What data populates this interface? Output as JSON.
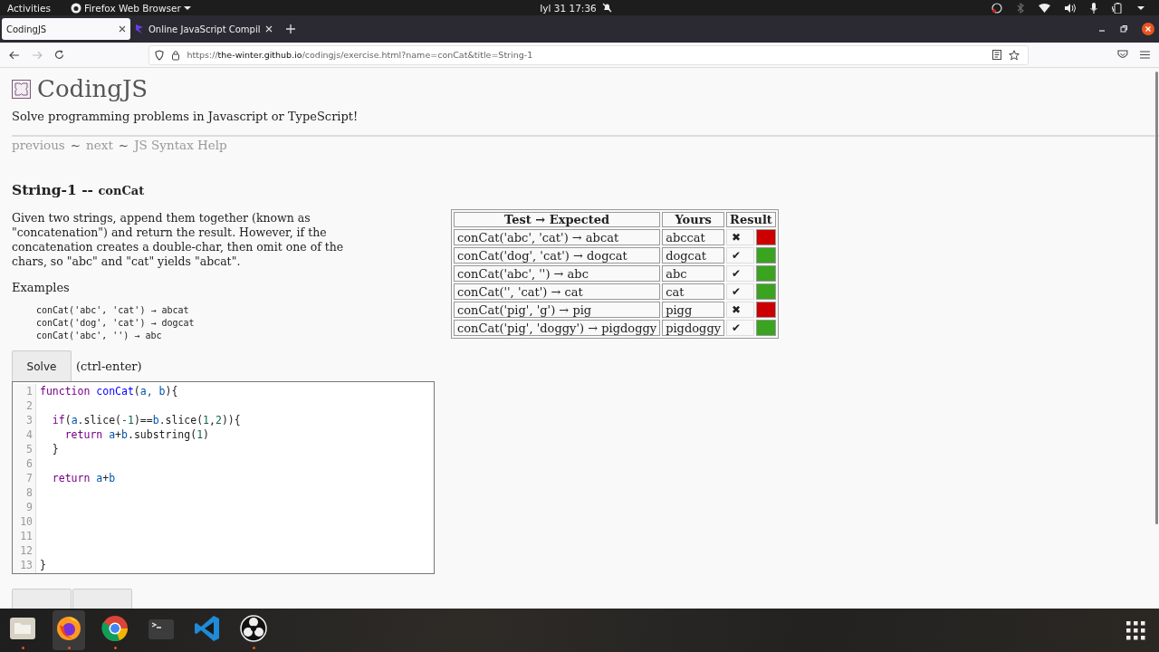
{
  "top_bar": {
    "activities": "Activities",
    "app_menu": "Firefox Web Browser",
    "clock": "Iyl 31  17:36"
  },
  "tabs": [
    {
      "title": "CodingJS",
      "selected": true
    },
    {
      "title": "Online JavaScript Compil",
      "selected": false
    }
  ],
  "address_bar": {
    "url_prefix": "https://",
    "url_host": "the-winter.github.io",
    "url_path": "/codingjs/exercise.html?name=conCat&title=String-1"
  },
  "page": {
    "logo_text": "CodingJS",
    "tagline": "Solve programming problems in Javascript or TypeScript!",
    "nav_links": [
      {
        "label": "previous"
      },
      {
        "label": "next"
      },
      {
        "label": "JS Syntax Help"
      }
    ],
    "nav_separator": "~",
    "title": "String-1 --",
    "title_name": "conCat",
    "description": "Given two strings, append them together (known as \"concatenation\") and return the result. However, if the concatenation creates a double-char, then omit one of the chars, so \"abc\" and \"cat\" yields \"abcat\".",
    "examples_label": "Examples",
    "examples": [
      "conCat('abc', 'cat') → abcat",
      "conCat('dog', 'cat') → dogcat",
      "conCat('abc', '') → abc"
    ],
    "solve_button": "Solve",
    "solve_hint": "(ctrl-enter)",
    "code_lines": [
      {
        "number": "1",
        "tokens": [
          {
            "text": "function",
            "kind": "keyword"
          },
          {
            "text": " conCat",
            "kind": "def"
          },
          {
            "text": "(",
            "kind": "plain"
          },
          {
            "text": "a",
            "kind": "var"
          },
          {
            "text": ", b",
            "kind": "var"
          },
          {
            "text": "){",
            "kind": "plain"
          }
        ]
      },
      {
        "number": "2"
      },
      {
        "number": "3",
        "tokens": [
          {
            "text": "  if",
            "kind": "keyword"
          },
          {
            "text": "(",
            "kind": "plain"
          },
          {
            "text": "a",
            "kind": "var"
          },
          {
            "text": ".slice(",
            "kind": "plain"
          },
          {
            "text": "-1",
            "kind": "number"
          },
          {
            "text": ")==",
            "kind": "plain"
          },
          {
            "text": "b",
            "kind": "var"
          },
          {
            "text": ".slice(",
            "kind": "plain"
          },
          {
            "text": "1",
            "kind": "number"
          },
          {
            "text": ",",
            "kind": "plain"
          },
          {
            "text": "2",
            "kind": "number"
          },
          {
            "text": ")){",
            "kind": "plain"
          }
        ]
      },
      {
        "number": "4",
        "tokens": [
          {
            "text": "    return",
            "kind": "keyword"
          },
          {
            "text": " a",
            "kind": "var"
          },
          {
            "text": "+",
            "kind": "plain"
          },
          {
            "text": "b",
            "kind": "var"
          },
          {
            "text": ".substring(",
            "kind": "plain"
          },
          {
            "text": "1",
            "kind": "number"
          },
          {
            "text": ")",
            "kind": "plain"
          }
        ]
      },
      {
        "number": "5",
        "tokens": [
          {
            "text": "  }",
            "kind": "plain"
          }
        ]
      },
      {
        "number": "6"
      },
      {
        "number": "7",
        "tokens": [
          {
            "text": "  return",
            "kind": "keyword"
          },
          {
            "text": " a",
            "kind": "var"
          },
          {
            "text": "+",
            "kind": "plain"
          },
          {
            "text": "b",
            "kind": "var"
          }
        ]
      },
      {
        "number": "8"
      },
      {
        "number": "9"
      },
      {
        "number": "10"
      },
      {
        "number": "11"
      },
      {
        "number": "12"
      },
      {
        "number": "13",
        "tokens": [
          {
            "text": "}",
            "kind": "plain"
          }
        ]
      }
    ],
    "results_table": {
      "columns": [
        "Test → Expected",
        "Yours",
        "Result"
      ],
      "rows": [
        {
          "test": "conCat('abc', 'cat') → abcat",
          "yours": "abccat",
          "mark": "✖",
          "passed": false
        },
        {
          "test": "conCat('dog', 'cat') → dogcat",
          "yours": "dogcat",
          "mark": "✔",
          "passed": true
        },
        {
          "test": "conCat('abc', '') → abc",
          "yours": "abc",
          "mark": "✔",
          "passed": true
        },
        {
          "test": "conCat('', 'cat') → cat",
          "yours": "cat",
          "mark": "✔",
          "passed": true
        },
        {
          "test": "conCat('pig', 'g') → pig",
          "yours": "pigg",
          "mark": "✖",
          "passed": false
        },
        {
          "test": "conCat('pig', 'doggy') → pigdoggy",
          "yours": "pigdoggy",
          "mark": "✔",
          "passed": true
        }
      ]
    }
  },
  "dock": {
    "apps": [
      {
        "kind": "files",
        "running": true
      },
      {
        "kind": "firefox",
        "running": true,
        "selected": true
      },
      {
        "kind": "chrome",
        "running": true
      },
      {
        "kind": "terminal",
        "running": false
      },
      {
        "kind": "vscode",
        "running": false
      },
      {
        "kind": "obs",
        "running": true
      }
    ]
  }
}
